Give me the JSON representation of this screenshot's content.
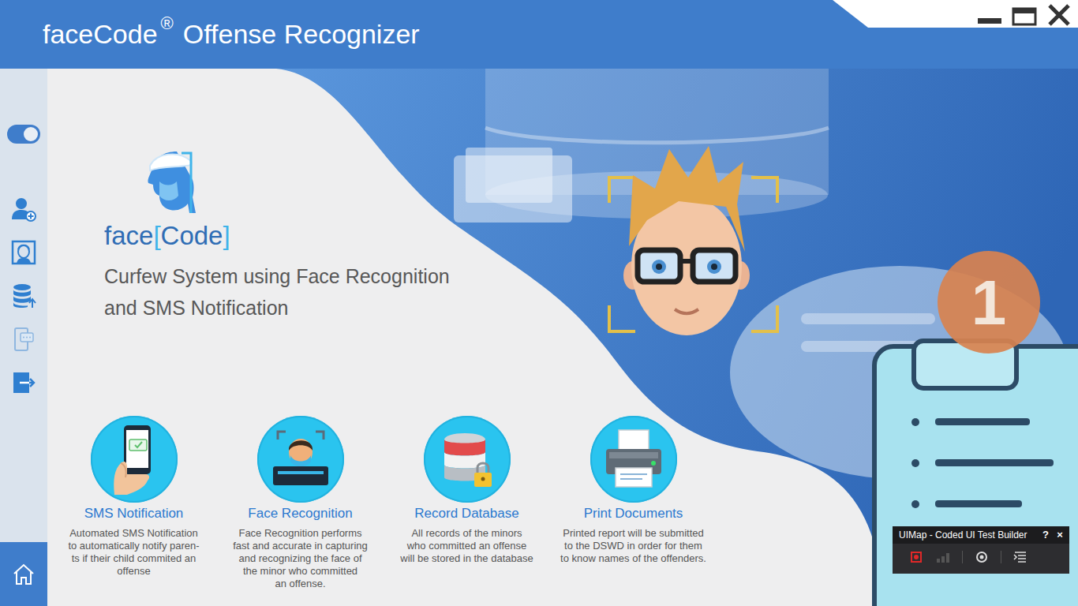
{
  "window": {
    "title": "faceCode",
    "mark": "®",
    "rest": "Offense Recognizer"
  },
  "sidebar": {
    "toggle": {
      "on": true
    },
    "items": [
      {
        "kind": "add-user",
        "selected": false
      },
      {
        "kind": "face-scan",
        "selected": false
      },
      {
        "kind": "database",
        "selected": false
      },
      {
        "kind": "sms",
        "selected": false
      },
      {
        "kind": "exit",
        "selected": false
      }
    ],
    "home": {
      "selected": true
    }
  },
  "hero": {
    "logo": [
      {
        "text": "face",
        "color": "#2f6db5"
      },
      {
        "text": "[",
        "color": "#3fb4ea"
      },
      {
        "text": "Code",
        "color": "#2f6db5"
      },
      {
        "text": "]",
        "color": "#3fb4ea"
      }
    ],
    "tagline": [
      "Curfew System using Face Recognition",
      "and SMS Notification"
    ]
  },
  "badge": "1",
  "features": [
    {
      "kind": "sms",
      "title": "SMS Notification",
      "lines": [
        "Automated SMS Notification",
        "to automatically notify paren-",
        "ts if their child commited an",
        "offense"
      ]
    },
    {
      "kind": "face",
      "title": "Face Recognition",
      "lines": [
        "Face Recognition performs",
        "fast and accurate in capturing",
        "and recognizing the face of",
        "the minor who committed",
        "an offense."
      ]
    },
    {
      "kind": "database",
      "title": "Record Database",
      "lines": [
        "All records of the minors",
        "who committed an offense",
        "will be stored in the database"
      ]
    },
    {
      "kind": "printer",
      "title": "Print Documents",
      "lines": [
        "Printed report will be submitted",
        "to the DSWD in order for them",
        "to know names of the offenders."
      ]
    }
  ],
  "test_builder": {
    "title": "UIMap - Coded UI Test Builder",
    "help": "?",
    "close": "×"
  }
}
